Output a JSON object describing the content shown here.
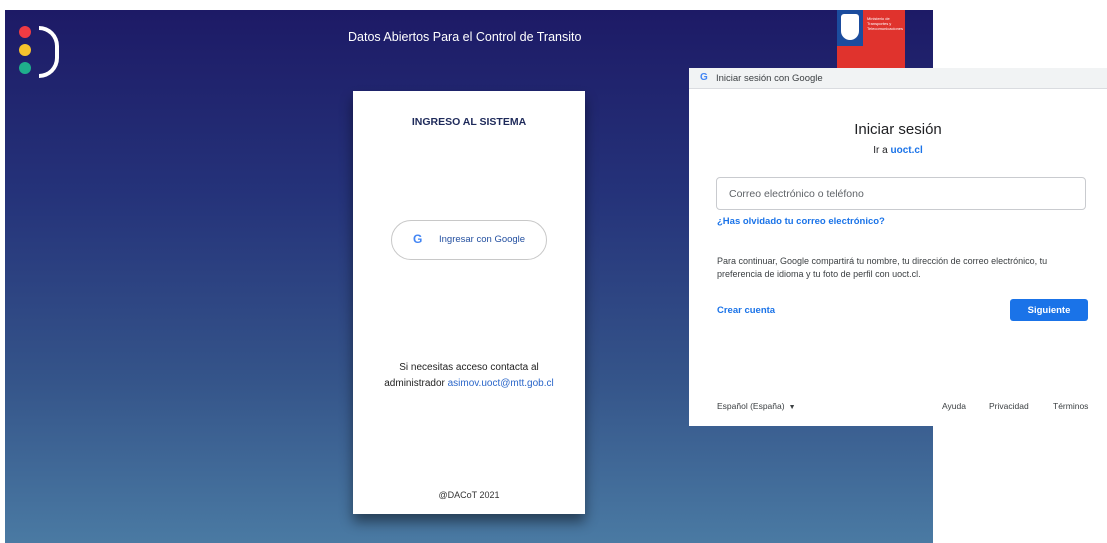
{
  "app": {
    "title": "Datos Abiertos Para el Control de Transito",
    "gov_logo_text": "Ministerio de Transportes y Telecomunicaciones"
  },
  "login_card": {
    "title": "INGRESO AL SISTEMA",
    "google_button_label": "Ingresar con Google",
    "access_note": "Si necesitas acceso contacta al",
    "access_note_prefix": "administrador",
    "admin_email": "asimov.uoct@mtt.gob.cl",
    "footer": "@DACoT 2021"
  },
  "google_popup": {
    "window_title": "Iniciar sesión con Google",
    "heading": "Iniciar sesión",
    "subheading_prefix": "Ir a",
    "subheading_site": "uoct.cl",
    "email_placeholder": "Correo electrónico o teléfono",
    "forgot_link": "¿Has olvidado tu correo electrónico?",
    "consent_text": "Para continuar, Google compartirá tu nombre, tu dirección de correo electrónico, tu preferencia de idioma y tu foto de perfil con uoct.cl.",
    "create_account": "Crear cuenta",
    "next_button": "Siguiente",
    "footer": {
      "language": "Español (España)",
      "help": "Ayuda",
      "privacy": "Privacidad",
      "terms": "Términos"
    }
  },
  "icons": {
    "google": "G",
    "caret": "▼"
  },
  "colors": {
    "google_blue": "#1a73e8",
    "logo_red": "#ef3b44",
    "logo_yellow": "#f6c32d",
    "logo_green": "#1fae8c"
  }
}
